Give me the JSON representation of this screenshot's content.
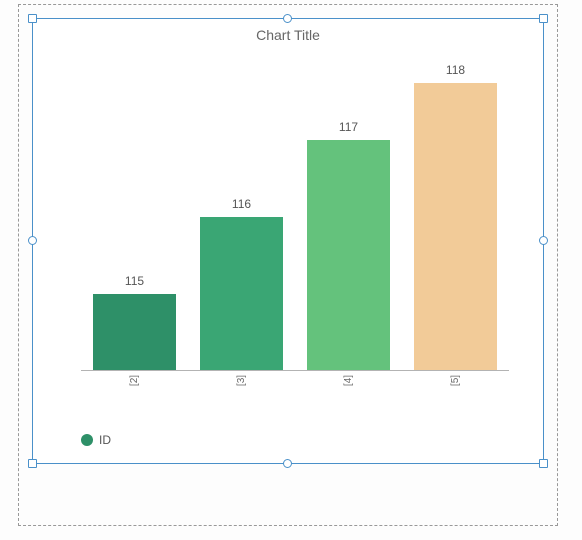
{
  "chart_data": {
    "type": "bar",
    "title": "Chart Title",
    "categories": [
      "[2]",
      "[3]",
      "[4]",
      "[5]"
    ],
    "series": [
      {
        "name": "ID",
        "values": [
          115,
          116,
          117,
          118
        ]
      }
    ],
    "legend_position": "bottom-left",
    "ylim": [
      114,
      118
    ]
  },
  "bar_colors": [
    "#2e9068",
    "#3aa674",
    "#64c27c",
    "#f2cb98"
  ],
  "legend_color": "#2e9068"
}
